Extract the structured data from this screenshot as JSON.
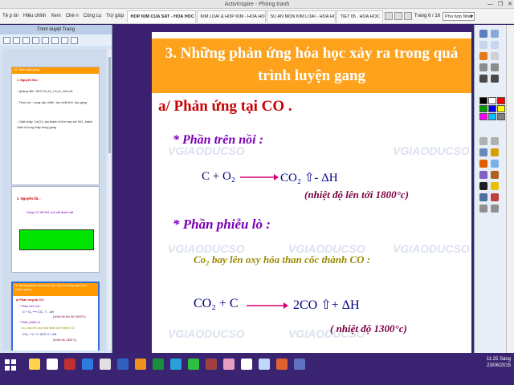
{
  "window": {
    "title": "ActivInspire - Phòng tranh",
    "controls": [
      "—",
      "❐",
      "✕"
    ]
  },
  "menu": {
    "items": [
      "Tệ p tin",
      "Hiệu chỉnh",
      "Xem",
      "Chè n",
      "Công cụ",
      "Trợ giúp"
    ]
  },
  "tabs": [
    {
      "label": "HOP KIM CUA SAT - HOA HOC 1",
      "active": true
    },
    {
      "label": "KIM LOAI & HOP KIM - HOA HOC 12",
      "active": false
    },
    {
      "label": "SU AN MON KIM LOAI - HOA HOC 1",
      "active": false
    },
    {
      "label": "TIET 65 , HOA HOC",
      "active": false
    }
  ],
  "page_indicator": "Trang 6 / 16",
  "zoom": {
    "selected": "Phù hợp Nhất"
  },
  "browser": {
    "title": "Trình duyệt Trang",
    "thumbs": [
      {
        "title": "III. Sản xuất gang",
        "lines": [
          "1. Nguyên liệu",
          "- Quặng sắt: >30% Fe₃O₄ ,Fe₂O₃ mới cốt",
          "- Than cốc : cung cấp nhiệt , tạo chất khử ,tạo gang",
          "- Chất chảy: CaCO₃ tạo thành xỉ lớn hợp với SiO₂ thành",
          "  chất xỉ trong chảy trong gang"
        ]
      },
      {
        "title": "2. Nguyên tắc .",
        "lines": [
          "Dùng CO để khử oxit sắt thành sắt"
        ]
      },
      {
        "title": "3. Những phản ứng hóa học xảy ra trong quá trình luyện gang",
        "lines": [
          "a/ Phản ứng tại CO .",
          "* Phần trên nồi :",
          "C + O₂ ⟶ CO₂ ⇧ - ΔH",
          "(nhiệt độ lên tới 1800°c)",
          "* Phần phiễu lò :",
          "Co₂ bay lên oxy hóa than cốc thành CO :",
          "CO₂ + C ⟶ 2CO ⇧+ ΔH",
          "(nhiệt độ 1300°c)"
        ]
      }
    ]
  },
  "slide": {
    "title_line1": "3. Những phản ứng hóa học xảy ra trong quá",
    "title_line2": "trình luyện gang",
    "heading": "a/ Phản ứng tại CO .",
    "section1": "* Phần trên nồi :",
    "eq1_left": "C + O₂",
    "eq1_right": "CO₂ ⇧- ΔH",
    "eq1_cond": "(nhiệt độ lên tới 1800°c)",
    "section2": "* Phần phiễu lò :",
    "line2": "Co₂ bay lên oxy hóa than cốc thành CO :",
    "eq2_left": "CO₂ + C",
    "eq2_right": "2CO ⇧+ ΔH",
    "eq2_cond": "( nhiệt độ 1300°c)",
    "watermark": "VGIAODUCSO"
  },
  "tray": {
    "time": "11:25 Sáng",
    "date": "23/06/2015"
  },
  "colors": {
    "title_bg": "#ffa21b",
    "heading": "#cc0000",
    "section": "#7b00b5",
    "equation": "#000080",
    "condition": "#7b0040",
    "olive": "#9a8a00",
    "taskbar": "#3a2472"
  }
}
